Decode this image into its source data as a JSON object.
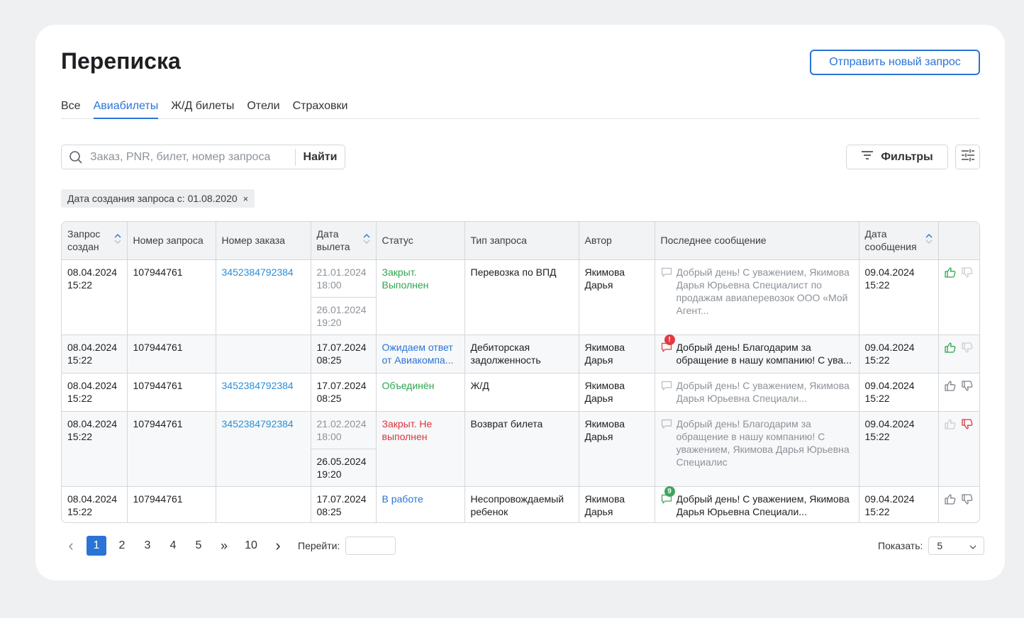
{
  "page": {
    "title": "Переписка",
    "new_request_button": "Отправить новый запрос"
  },
  "tabs": [
    {
      "label": "Все",
      "active": false
    },
    {
      "label": "Авиабилеты",
      "active": true
    },
    {
      "label": "Ж/Д билеты",
      "active": false
    },
    {
      "label": "Отели",
      "active": false
    },
    {
      "label": "Страховки",
      "active": false
    }
  ],
  "search": {
    "placeholder": "Заказ, PNR, билет, номер запроса",
    "value": "",
    "button": "Найти"
  },
  "filters": {
    "button": "Фильтры",
    "active_chip": "Дата создания запроса с: 01.08.2020",
    "chip_close": "×"
  },
  "table": {
    "columns": [
      {
        "label": "Запрос создан",
        "sortable": true
      },
      {
        "label": "Номер запроса",
        "sortable": false
      },
      {
        "label": "Номер заказа",
        "sortable": false
      },
      {
        "label": "Дата вылета",
        "sortable": true
      },
      {
        "label": "Статус",
        "sortable": false
      },
      {
        "label": "Тип запроса",
        "sortable": false
      },
      {
        "label": "Автор",
        "sortable": false
      },
      {
        "label": "Последнее сообщение",
        "sortable": false
      },
      {
        "label": "Дата сообщения",
        "sortable": true
      },
      {
        "label": "",
        "sortable": false
      }
    ],
    "rows": [
      {
        "created": "08.04.2024 15:22",
        "request_no": "107944761",
        "order_no": "3452384792384",
        "departures": [
          {
            "date": "21.01.2024 18:00",
            "muted": true
          },
          {
            "date": "26.01.2024 19:20",
            "muted": true
          }
        ],
        "status": "Закрыт. Выполнен",
        "status_color": "green",
        "type": "Перевозка по ВПД",
        "author": "Якимова Дарья",
        "message": "Добрый день! С уважением, Якимова Дарья Юрьевна Специалист по продажам авиаперевозок ООО «Мой Агент...",
        "message_muted": true,
        "message_badge": "",
        "message_badge_color": "",
        "message_date": "09.04.2024 15:22",
        "like": "active",
        "dislike": "muted"
      },
      {
        "created": "08.04.2024 15:22",
        "request_no": "107944761",
        "order_no": "",
        "departures": [
          {
            "date": "17.07.2024 08:25",
            "muted": false
          }
        ],
        "status": "Ожидаем ответ от Авиакомпа...",
        "status_color": "blue",
        "type": "Дебиторская задолженность",
        "author": "Якимова Дарья",
        "message": "Добрый день! Благодарим за обращение в нашу компанию! С ува...",
        "message_muted": false,
        "message_badge": "!",
        "message_badge_color": "red",
        "message_date": "09.04.2024 15:22",
        "like": "active",
        "dislike": "muted"
      },
      {
        "created": "08.04.2024 15:22",
        "request_no": "107944761",
        "order_no": "3452384792384",
        "departures": [
          {
            "date": "17.07.2024 08:25",
            "muted": false
          }
        ],
        "status": "Объединён",
        "status_color": "green",
        "type": "Ж/Д",
        "author": "Якимова Дарья",
        "message": "Добрый день! С уважением, Якимова Дарья Юрьевна Специали...",
        "message_muted": true,
        "message_badge": "",
        "message_badge_color": "",
        "message_date": "09.04.2024 15:22",
        "like": "default",
        "dislike": "default"
      },
      {
        "created": "08.04.2024 15:22",
        "request_no": "107944761",
        "order_no": "3452384792384",
        "departures": [
          {
            "date": "21.02.2024 18:00",
            "muted": true
          },
          {
            "date": "26.05.2024 19:20",
            "muted": false
          }
        ],
        "status": "Закрыт. Не выполнен",
        "status_color": "red",
        "type": "Возврат билета",
        "author": "Якимова Дарья",
        "message": "Добрый день! Благодарим за обращение в нашу компанию! С уважением, Якимова Дарья Юрьевна Специалис",
        "message_muted": true,
        "message_badge": "",
        "message_badge_color": "",
        "message_date": "09.04.2024 15:22",
        "like": "muted",
        "dislike": "negative"
      },
      {
        "created": "08.04.2024 15:22",
        "request_no": "107944761",
        "order_no": "",
        "departures": [
          {
            "date": "17.07.2024 08:25",
            "muted": false
          }
        ],
        "status": "В работе",
        "status_color": "blue",
        "type": "Несопровождаемый ребенок",
        "author": "Якимова Дарья",
        "message": "Добрый день! С уважением, Якимова Дарья Юрьевна Специали...",
        "message_muted": false,
        "message_badge": "9",
        "message_badge_color": "green",
        "message_date": "09.04.2024 15:22",
        "like": "default",
        "dislike": "default"
      }
    ]
  },
  "pagination": {
    "prev": "‹",
    "pages": [
      "1",
      "2",
      "3",
      "4",
      "5"
    ],
    "current": "1",
    "jump": "»",
    "last": "10",
    "next": "›",
    "goto_label": "Перейти:",
    "goto_value": "",
    "show_label": "Показать:",
    "page_size": "5"
  },
  "colors": {
    "accent": "#2a74d6",
    "link": "#2a8fd6",
    "green": "#2ea44f",
    "red": "#d9363e",
    "muted": "#8d9299"
  }
}
